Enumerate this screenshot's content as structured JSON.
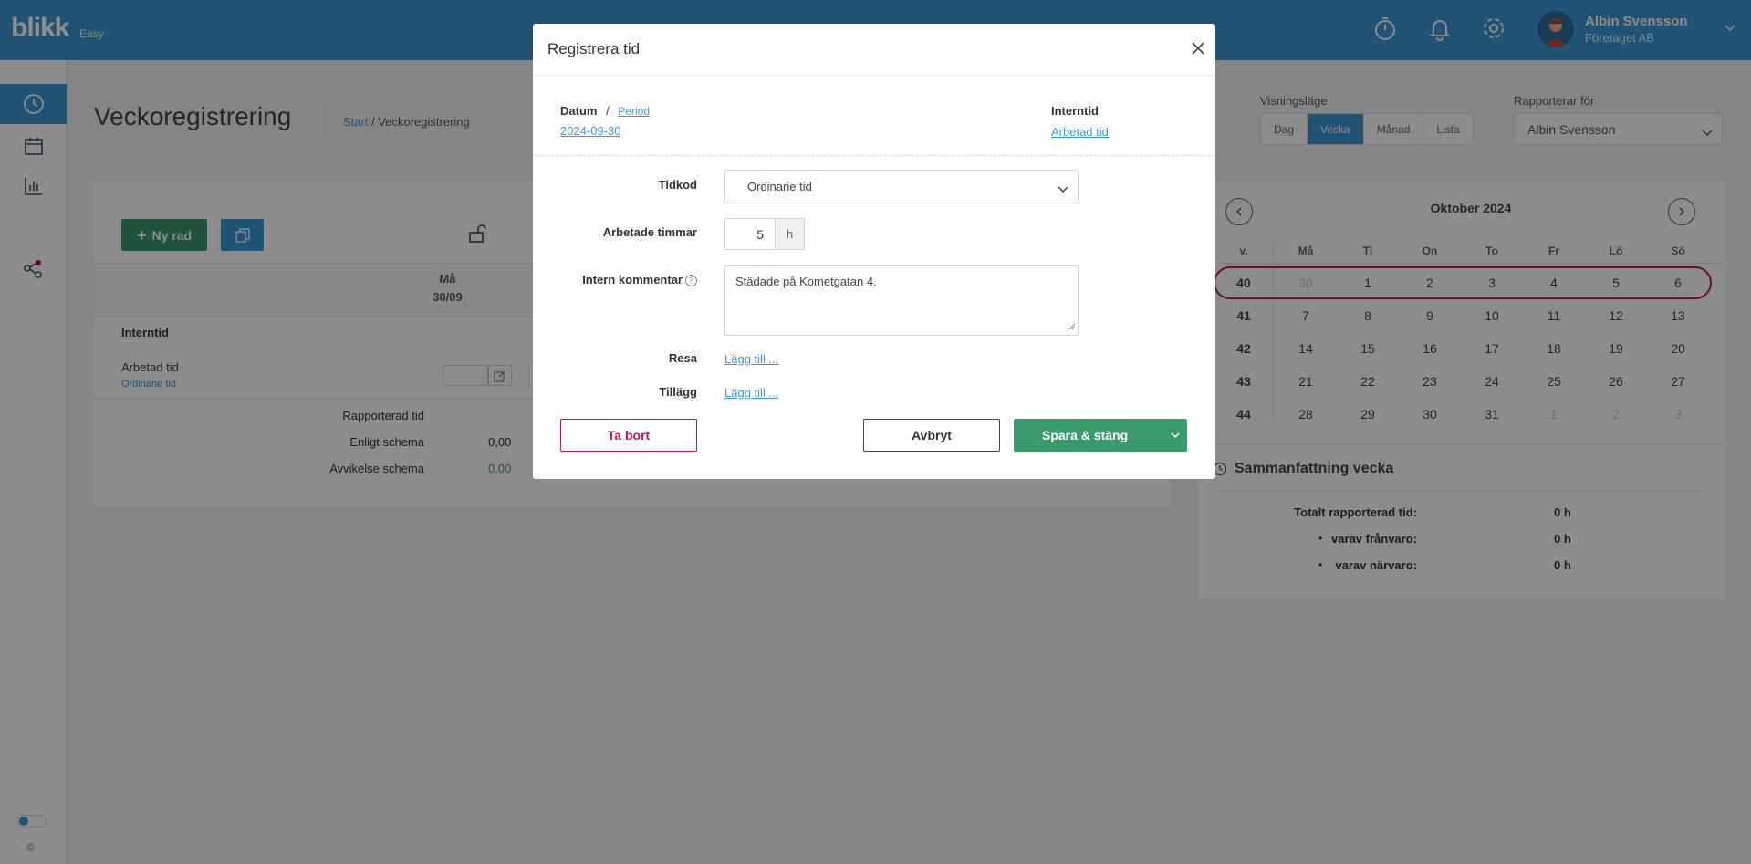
{
  "app": {
    "logo": "blikk",
    "logo_sub": "Easy"
  },
  "user": {
    "name": "Albin Svensson",
    "company": "Företaget AB"
  },
  "page": {
    "title": "Veckoregistrering",
    "breadcrumb_start": "Start",
    "breadcrumb_sep": " / ",
    "breadcrumb_current": "Veckoregistrering"
  },
  "toolbar": {
    "new_row": "Ny rad"
  },
  "grid": {
    "day_name": "Må",
    "day_date": "30/09",
    "section": "Interntid",
    "row_label": "Arbetad tid",
    "row_sublabel": "Ordinarie tid",
    "summary": [
      {
        "label": "Rapporterad tid",
        "value": ""
      },
      {
        "label": "Enligt schema",
        "value": "0,00"
      },
      {
        "label": "Avvikelse schema",
        "value": "0,00"
      }
    ]
  },
  "view": {
    "label": "Visningsläge",
    "options": [
      "Dag",
      "Vecka",
      "Månad",
      "Lista"
    ],
    "active": "Vecka",
    "report_label": "Rapporterar för",
    "report_value": "Albin Svensson"
  },
  "calendar": {
    "title": "Oktober 2024",
    "headers": [
      "v.",
      "Må",
      "Ti",
      "On",
      "To",
      "Fr",
      "Lö",
      "Sö"
    ],
    "weeks": [
      {
        "week": "40",
        "days": [
          "30",
          "1",
          "2",
          "3",
          "4",
          "5",
          "6"
        ]
      },
      {
        "week": "41",
        "days": [
          "7",
          "8",
          "9",
          "10",
          "11",
          "12",
          "13"
        ]
      },
      {
        "week": "42",
        "days": [
          "14",
          "15",
          "16",
          "17",
          "18",
          "19",
          "20"
        ]
      },
      {
        "week": "43",
        "days": [
          "21",
          "22",
          "23",
          "24",
          "25",
          "26",
          "27"
        ]
      },
      {
        "week": "44",
        "days": [
          "28",
          "29",
          "30",
          "31",
          "1",
          "2",
          "3"
        ]
      }
    ]
  },
  "week_summary": {
    "title": "Sammanfattning vecka",
    "total_label": "Totalt rapporterad tid:",
    "total_value": "0 h",
    "absence_label": "varav frånvaro:",
    "absence_value": "0 h",
    "presence_label": "varav närvaro:",
    "presence_value": "0 h"
  },
  "modal": {
    "title": "Registrera tid",
    "date_label": "Datum",
    "date_sep": "/",
    "period_link": "Period",
    "date_value": "2024-09-30",
    "internal_label": "Interntid",
    "internal_link": "Arbetad tid",
    "timecode_label": "Tidkod",
    "timecode_value": "Ordinarie tid",
    "hours_label": "Arbetade timmar",
    "hours_value": "5",
    "hours_unit": "h",
    "comment_label": "Intern kommentar",
    "comment_value": "Städade på Kometgatan 4.",
    "travel_label": "Resa",
    "travel_link": "Lägg till ...",
    "addon_label": "Tillägg",
    "addon_link": "Lägg till ...",
    "delete_label": "Ta bort",
    "cancel_label": "Avbryt",
    "save_label": "Spara & stäng"
  },
  "footer": {
    "copyright": "©"
  }
}
